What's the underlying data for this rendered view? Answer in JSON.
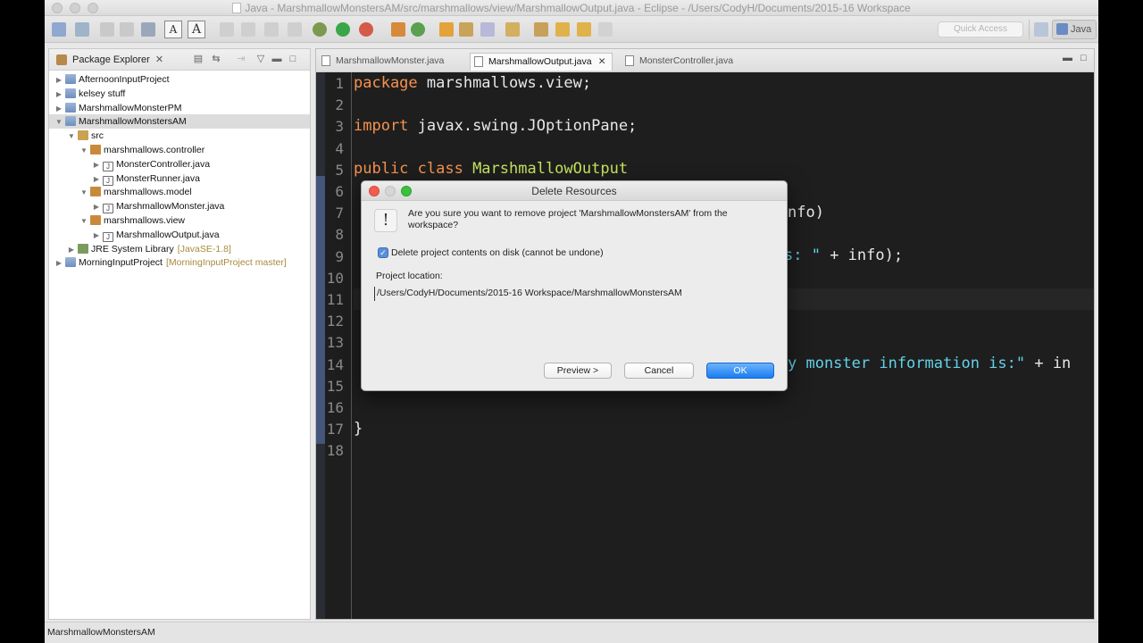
{
  "window": {
    "title": "Java - MarshmallowMonstersAM/src/marshmallows/view/MarshmallowOutput.java - Eclipse - /Users/CodyH/Documents/2015-16 Workspace"
  },
  "toolbar": {
    "quick_access_placeholder": "Quick Access",
    "perspective_label": "Java",
    "font_small": "A",
    "font_large": "A"
  },
  "package_explorer": {
    "title": "Package Explorer",
    "items": [
      {
        "label": "AfternoonInputProject",
        "depth": 0,
        "expanded": false,
        "type": "project"
      },
      {
        "label": "kelsey stuff",
        "depth": 0,
        "expanded": false,
        "type": "project"
      },
      {
        "label": "MarshmallowMonsterPM",
        "depth": 0,
        "expanded": false,
        "type": "project"
      },
      {
        "label": "MarshmallowMonstersAM",
        "depth": 0,
        "expanded": true,
        "type": "project",
        "selected": true
      },
      {
        "label": "src",
        "depth": 1,
        "expanded": true,
        "type": "src"
      },
      {
        "label": "marshmallows.controller",
        "depth": 2,
        "expanded": true,
        "type": "package"
      },
      {
        "label": "MonsterController.java",
        "depth": 3,
        "expanded": false,
        "type": "java"
      },
      {
        "label": "MonsterRunner.java",
        "depth": 3,
        "expanded": false,
        "type": "java"
      },
      {
        "label": "marshmallows.model",
        "depth": 2,
        "expanded": true,
        "type": "package"
      },
      {
        "label": "MarshmallowMonster.java",
        "depth": 3,
        "expanded": false,
        "type": "java"
      },
      {
        "label": "marshmallows.view",
        "depth": 2,
        "expanded": true,
        "type": "package"
      },
      {
        "label": "MarshmallowOutput.java",
        "depth": 3,
        "expanded": false,
        "type": "java"
      },
      {
        "label": "JRE System Library",
        "depth": 1,
        "expanded": false,
        "type": "jre",
        "decoration": "[JavaSE-1.8]"
      },
      {
        "label": "MorningInputProject",
        "depth": 0,
        "expanded": false,
        "type": "project",
        "decoration": "[MorningInputProject master]"
      }
    ]
  },
  "editor": {
    "tabs": [
      {
        "label": "MarshmallowMonster.java",
        "active": false
      },
      {
        "label": "MarshmallowOutput.java",
        "active": true
      },
      {
        "label": "MonsterController.java",
        "active": false
      }
    ],
    "line_numbers": [
      "1",
      "2",
      "3",
      "4",
      "5",
      "6",
      "7",
      "8",
      "9",
      "10",
      "11",
      "12",
      "13",
      "14",
      "15",
      "16",
      "17",
      "18"
    ],
    "lines": {
      "l1_kw": "package",
      "l1_rest": " marshmallows.view;",
      "l3_kw": "import",
      "l3_rest": " javax.swing.JOptionPane;",
      "l5_kw": "public class",
      "l5_cls": " MarshmallowOutput",
      "l7_frag": "nfo)",
      "l9_str": "s: \"",
      "l9_rest": " + info);",
      "l14_str": "y monster information is:\"",
      "l14_rest": " + in",
      "l17": "}"
    }
  },
  "dialog": {
    "title": "Delete Resources",
    "message": "Are you sure you want to remove project 'MarshmallowMonstersAM' from the workspace?",
    "checkbox_label": "Delete project contents on disk (cannot be undone)",
    "checkbox_checked": true,
    "location_label": "Project location:",
    "location_value": "/Users/CodyH/Documents/2015-16 Workspace/MarshmallowMonstersAM",
    "preview_label": "Preview >",
    "cancel_label": "Cancel",
    "ok_label": "OK"
  },
  "status": {
    "text": "MarshmallowMonstersAM"
  },
  "colors": {
    "keyword": "#f7924e",
    "class_name": "#c5e35f",
    "string": "#62d2e8",
    "editor_bg": "#1e1e1e",
    "ok_button": "#1a7cf2"
  }
}
